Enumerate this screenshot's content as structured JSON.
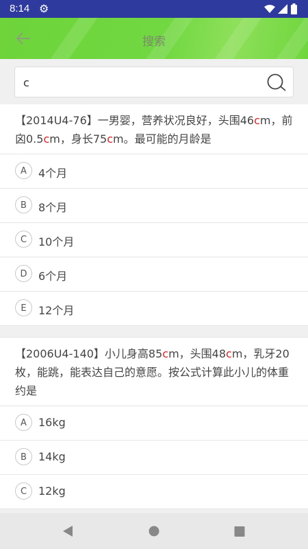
{
  "status_bar": {
    "time": "8:14"
  },
  "toolbar": {
    "title": "搜索"
  },
  "search": {
    "value": "c"
  },
  "questions": [
    {
      "parts": [
        {
          "t": "【2014U4-76】一男婴，营养状况良好，头围46"
        },
        {
          "t": "c",
          "hl": true
        },
        {
          "t": "m，前囟0.5"
        },
        {
          "t": "c",
          "hl": true
        },
        {
          "t": "m，身长75"
        },
        {
          "t": "c",
          "hl": true
        },
        {
          "t": "m。最可能的月龄是"
        }
      ],
      "options": [
        {
          "letter": "A",
          "text": "4个月"
        },
        {
          "letter": "B",
          "text": "8个月"
        },
        {
          "letter": "C",
          "text": "10个月"
        },
        {
          "letter": "D",
          "text": "6个月"
        },
        {
          "letter": "E",
          "text": "12个月"
        }
      ]
    },
    {
      "parts": [
        {
          "t": "【2006U4-140】小儿身高85"
        },
        {
          "t": "c",
          "hl": true
        },
        {
          "t": "m，头围48"
        },
        {
          "t": "c",
          "hl": true
        },
        {
          "t": "m，乳牙20枚，能跳，能表达自己的意愿。按公式计算此小儿的体重约是"
        }
      ],
      "options": [
        {
          "letter": "A",
          "text": "16kg"
        },
        {
          "letter": "B",
          "text": "14kg"
        },
        {
          "letter": "C",
          "text": "12kg"
        }
      ]
    }
  ],
  "colors": {
    "status_bar": "#2e3a9e",
    "toolbar": "#72d842",
    "highlight": "#e02020"
  },
  "icons": {
    "back": "arrow-left-icon",
    "search": "magnifier-icon",
    "settings": "gear-icon"
  }
}
